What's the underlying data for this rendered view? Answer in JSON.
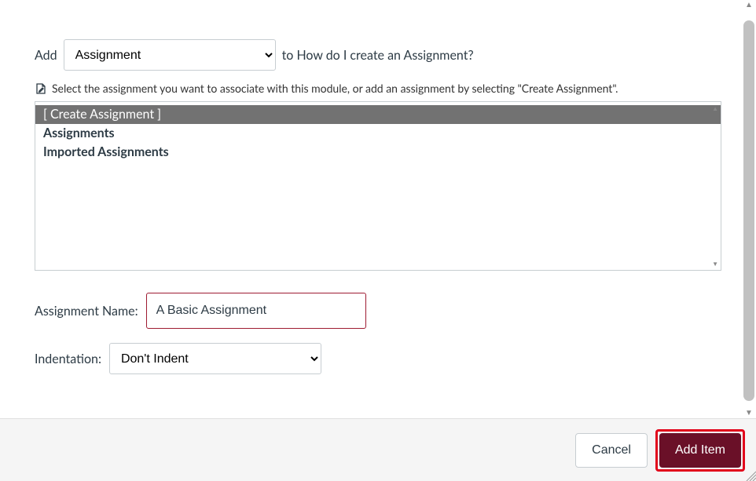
{
  "addRow": {
    "prefix": "Add",
    "typeSelected": "Assignment",
    "suffix": "to How do I create an Assignment?"
  },
  "helperText": "Select the assignment you want to associate with this module, or add an assignment by selecting \"Create Assignment\".",
  "listOptions": {
    "0": {
      "label": "[ Create Assignment ]",
      "selected": true
    },
    "1": {
      "label": "Assignments",
      "selected": false
    },
    "2": {
      "label": "Imported Assignments",
      "selected": false
    }
  },
  "nameField": {
    "label": "Assignment Name:",
    "value": "A Basic Assignment"
  },
  "indentField": {
    "label": "Indentation:",
    "selected": "Don't Indent"
  },
  "footer": {
    "cancel": "Cancel",
    "addItem": "Add Item"
  }
}
